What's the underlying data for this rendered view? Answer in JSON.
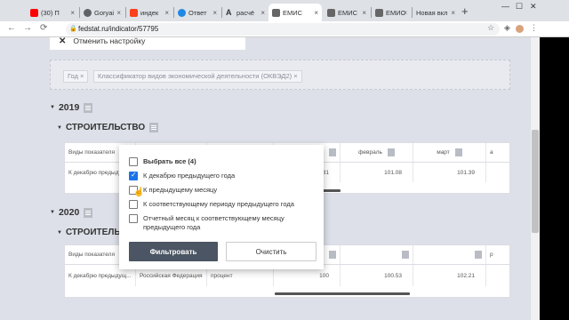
{
  "browser": {
    "tabs": [
      {
        "label": "(30) П",
        "color": "#ff0000"
      },
      {
        "label": "Goryai",
        "color": "#5f6368"
      },
      {
        "label": "индек",
        "color": "#fc3f1d"
      },
      {
        "label": "Ответ",
        "color": "#1e88e5"
      },
      {
        "label": "расчё",
        "color": "#222222"
      },
      {
        "label": "ЕМИС",
        "color": "#444444"
      },
      {
        "label": "ЕМИС",
        "color": "#444444"
      },
      {
        "label": "ЕМИС",
        "color": "#444444"
      },
      {
        "label": "Новая вкл",
        "color": ""
      }
    ],
    "new_tab": "+",
    "url": "fedstat.ru/indicator/57795"
  },
  "page": {
    "cancel_label": "Отменить настройку",
    "filter_chips": [
      "Год ×",
      "Классификатор видов экономической деятельности (ОКВЭД2) ×"
    ],
    "year1": "2019",
    "section1": "СТРОИТЕЛЬСТВО",
    "year2": "2020",
    "section2": "СТРОИТЕЛЬС",
    "table1": {
      "headers": [
        "Виды показателя",
        "",
        "",
        "",
        "февраль",
        "март",
        "а"
      ],
      "row": [
        "К декабрю предыдущ...",
        "",
        "",
        "100.81",
        "101.08",
        "101.39",
        ""
      ]
    },
    "table2": {
      "headers": [
        "Виды показателя",
        "",
        "",
        "",
        "",
        "",
        "р"
      ],
      "row": [
        "К декабрю предыдущ...",
        "Российская Федерация",
        "процент",
        "100",
        "100.53",
        "102.21",
        ""
      ]
    }
  },
  "popup": {
    "options": [
      {
        "label": "Выбрать все (4)",
        "checked": false,
        "bold": true
      },
      {
        "label": "К декабрю предыдущего года",
        "checked": true,
        "bold": false
      },
      {
        "label": "К предыдущему месяцу",
        "checked": false,
        "bold": false
      },
      {
        "label": "К соответствующему периоду предыдущего года",
        "checked": false,
        "bold": false
      },
      {
        "label": "Отчетный месяц к соответствующему месяцу предыдущего года",
        "checked": false,
        "bold": false
      }
    ],
    "filter_button": "Фильтровать",
    "clear_button": "Очистить"
  }
}
